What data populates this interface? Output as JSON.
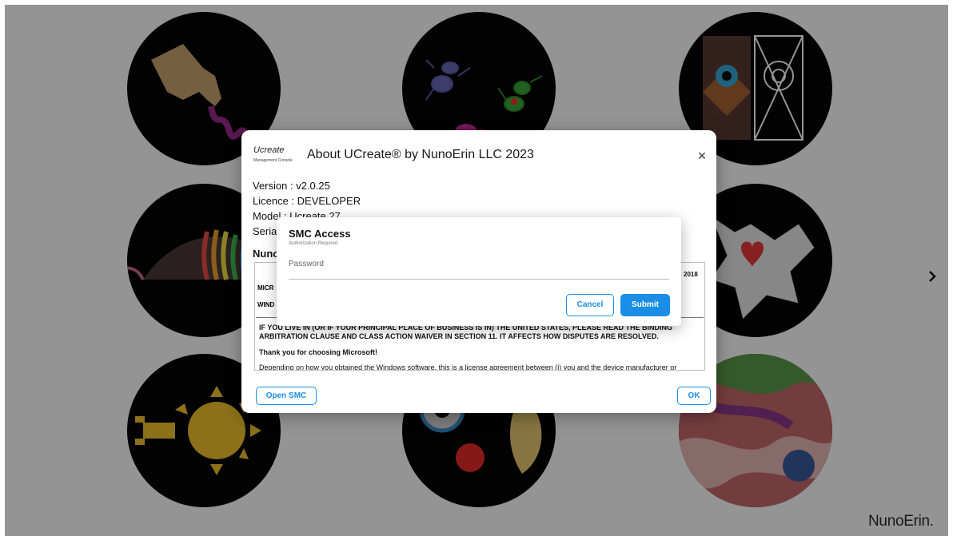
{
  "background": {
    "next_arrow": "chevron-right-icon",
    "brand": "NunoErin."
  },
  "about_dialog": {
    "logo_word": "Ucreate",
    "logo_sub": "Management Console",
    "title": "About UCreate® by NunoErin LLC 2023",
    "close": "×",
    "version": "Version : v2.0.25",
    "licence": "Licence : DEVELOPER",
    "model": "Model : Ucreate 27",
    "serial_label": "Seria",
    "nuno_label": "Nuno",
    "year_tag": "2018",
    "eula_head1": "MICR",
    "eula_head2": "WIND",
    "eula_arbitration": "IF YOU LIVE IN (OR IF YOUR PRINCIPAL PLACE OF BUSINESS IS IN) THE UNITED STATES, PLEASE READ THE BINDING ARBITRATION CLAUSE AND CLASS ACTION WAIVER IN SECTION 11. IT AFFECTS HOW DISPUTES ARE RESOLVED.",
    "eula_thanks": "Thank you for choosing Microsoft!",
    "eula_depending": "Depending on how you obtained the Windows software, this is a license agreement between (i) you and the device manufacturer or",
    "open_smc_label": "Open SMC",
    "ok_label": "OK"
  },
  "smc_modal": {
    "title": "SMC Access",
    "subtitle": "Authorization Required",
    "password_placeholder": "Password",
    "password_value": "",
    "cancel_label": "Cancel",
    "submit_label": "Submit"
  },
  "colors": {
    "accent": "#1a8ee6",
    "overlay": "rgba(0,0,0,0.42)"
  }
}
